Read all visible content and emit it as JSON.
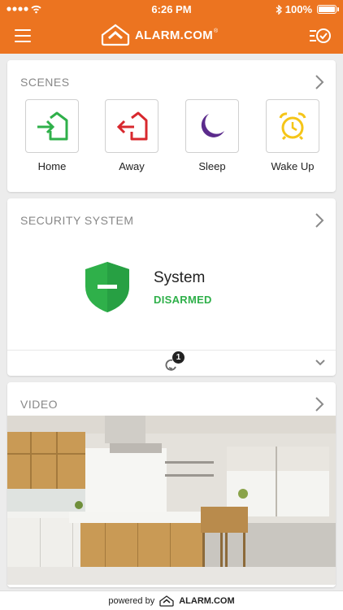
{
  "status_bar": {
    "time": "6:26 PM",
    "battery": "100%"
  },
  "header": {
    "brand": "ALARM.COM",
    "brand_mark": "®"
  },
  "scenes": {
    "title": "SCENES",
    "items": [
      {
        "label": "Home",
        "icon": "arrive-home-icon",
        "color": "#2fb04a"
      },
      {
        "label": "Away",
        "icon": "leave-home-icon",
        "color": "#d8282e"
      },
      {
        "label": "Sleep",
        "icon": "moon-icon",
        "color": "#5b2b8c"
      },
      {
        "label": "Wake Up",
        "icon": "alarm-clock-icon",
        "color": "#f5c518"
      }
    ]
  },
  "security": {
    "title": "SECURITY SYSTEM",
    "system_name": "System",
    "state": "DISARMED",
    "state_color": "#2fb04a",
    "pending_count": "1"
  },
  "video": {
    "title": "VIDEO"
  },
  "footer": {
    "powered": "powered by",
    "brand": "ALARM.COM"
  },
  "colors": {
    "accent": "#ec7420",
    "success": "#2fb04a"
  }
}
